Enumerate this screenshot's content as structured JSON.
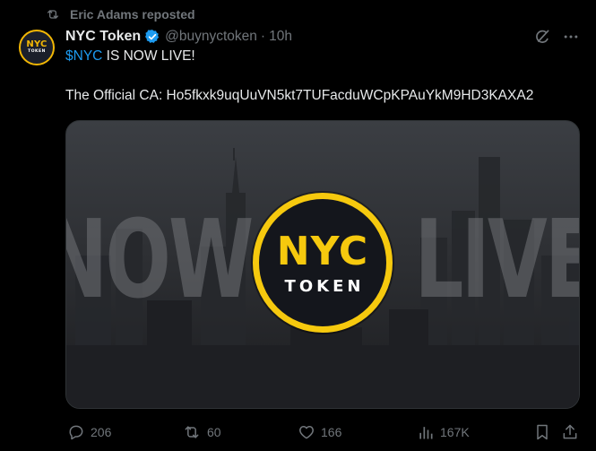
{
  "repost": {
    "label": "Eric Adams reposted"
  },
  "avatar": {
    "line1": "NYC",
    "line2": "TOKEN"
  },
  "author": {
    "display_name": "NYC Token",
    "handle": "@buynyctoken",
    "separator": "·",
    "time": "10h",
    "verified": true
  },
  "post": {
    "cashtag": "$NYC",
    "line1_rest": " IS NOW LIVE!",
    "line2": "The Official CA: Ho5fkxk9uqUuVN5kt7TUFacduWCpKPAuYkM9HD3KAXA2"
  },
  "media": {
    "bg_left": "NOW",
    "bg_right": "LIVE",
    "logo_main": "NYC",
    "logo_sub": "TOKEN"
  },
  "actions": {
    "replies": "206",
    "reposts": "60",
    "likes": "166",
    "views": "167K"
  },
  "colors": {
    "background": "#000000",
    "text": "#e7e9ea",
    "muted": "#71767b",
    "accent": "#1d9bf0",
    "logo_gold": "#f6c90e"
  }
}
